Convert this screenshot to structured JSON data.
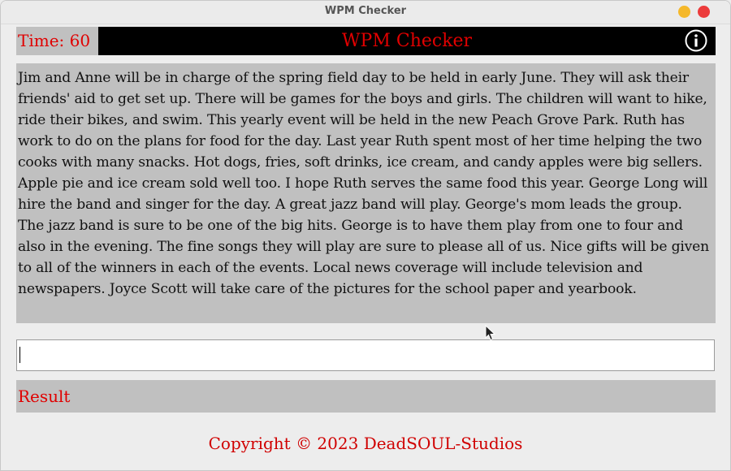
{
  "window": {
    "title": "WPM Checker"
  },
  "header": {
    "timer": "Time: 60",
    "title": "WPM Checker",
    "info_icon": "info-icon"
  },
  "passage": {
    "text": "Jim and Anne will be in charge of the spring field day to be held in early June. They will ask their friends' aid to get set up. There will be games for the boys and girls. The children will want to hike, ride their bikes, and swim. This yearly event will be held in the new Peach Grove Park. Ruth has work to do on the plans for food for the day. Last year Ruth spent most of her time helping the two cooks with many snacks. Hot dogs, fries, soft drinks, ice cream, and candy apples were big sellers. Apple pie and ice cream sold well too. I hope Ruth serves the same food this year. George Long will hire the band and singer for the day. A great jazz band will play. George's mom leads the group. The jazz band is sure to be one of the big hits. George is to have them play from one to four and also in the evening. The fine songs they will play are sure to please all of us. Nice gifts will be given to all of the winners in each of the events. Local news coverage will include television and newspapers. Joyce Scott will take care of the pictures for the school paper and yearbook."
  },
  "input": {
    "value": "",
    "placeholder": ""
  },
  "result": {
    "label": "Result"
  },
  "footer": {
    "copyright": "Copyright © 2023 DeadSOUL-Studios"
  },
  "colors": {
    "accent": "#e00000",
    "panel": "#c0c0c0",
    "header_bg": "#000000",
    "minimize": "#f5b82a",
    "close": "#ec3b3b"
  }
}
